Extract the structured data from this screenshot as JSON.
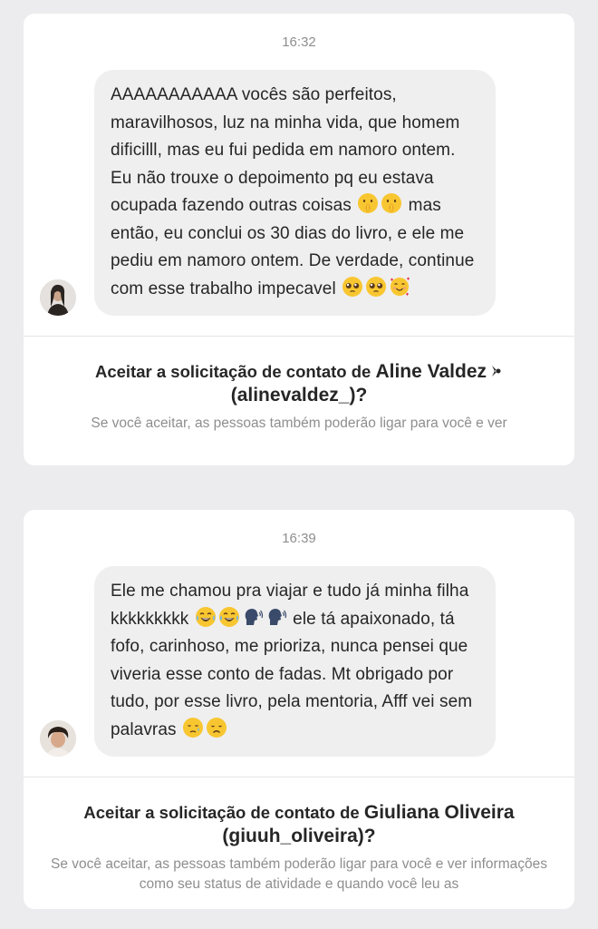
{
  "messages": [
    {
      "time": "16:32",
      "text_parts": [
        "AAAAAAAAAAA vocês são perfeitos, maravilhosos, luz na minha vida, que homem dificilll, mas eu fui pedida em namoro ontem. Eu não trouxe o depoimento pq eu estava ocupada fazendo outras coisas ",
        " mas então, eu conclui os 30 dias do livro, e ele me pediu em namoro ontem. De verdade, continue com esse trabalho impecavel "
      ],
      "emojis": [
        "shush-face-emoji",
        "shush-face-emoji",
        "pleading-face-emoji",
        "pleading-face-emoji",
        "smiling-face-with-hearts-emoji"
      ],
      "accept_prefix": "Aceitar a solicitação de contato de",
      "accept_name": "Aline Valdez",
      "accept_handle": "(alinevaldez_)?",
      "subtext": "Se você aceitar, as pessoas também poderão ligar para você e ver"
    },
    {
      "time": "16:39",
      "text_parts": [
        "Ele me chamou pra viajar e tudo já minha filha kkkkkkkkk ",
        " ele tá apaixonado, tá fofo, carinhoso, me prioriza, nunca pensei que viveria esse conto de fadas. Mt obrigado por tudo, por esse livro, pela mentoria, Afff vei sem palavras "
      ],
      "emojis": [
        "tears-of-joy-emoji",
        "tears-of-joy-emoji",
        "speaking-head-emoji",
        "speaking-head-emoji",
        "sad-relieved-emoji",
        "disappointed-emoji"
      ],
      "accept_prefix": "Aceitar a solicitação de contato de",
      "accept_name": "Giuliana Oliveira",
      "accept_handle": "(giuuh_oliveira)?",
      "subtext": "Se você aceitar, as pessoas também poderão ligar para você e ver informações como seu status de atividade e quando você leu as"
    }
  ],
  "colors": {
    "page_bg": "#ececee",
    "card_bg": "#ffffff",
    "bubble_bg": "#efefef",
    "text": "#262626",
    "muted": "#8e8e8e"
  }
}
